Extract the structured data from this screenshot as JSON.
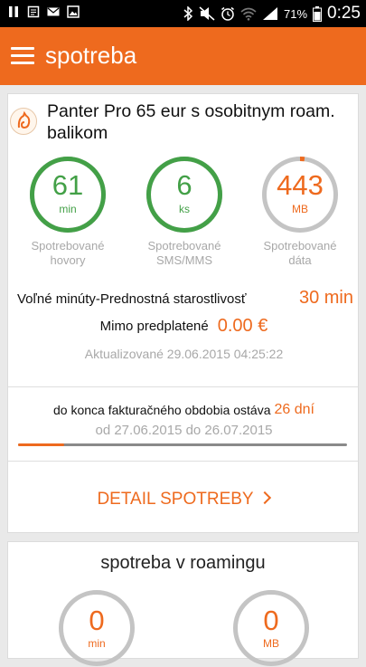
{
  "status_bar": {
    "battery_percent_label": "71%",
    "time": "0:25",
    "icons": [
      "pause-icon",
      "notes-icon",
      "mail-icon",
      "image-icon",
      "bluetooth-icon",
      "mute-icon",
      "alarm-icon",
      "wifi-icon",
      "signal-icon",
      "battery-icon"
    ]
  },
  "app_bar": {
    "title": "spotreba"
  },
  "plan": {
    "name": "Panter Pro 65 eur s osobitnym roam. balikom"
  },
  "gauges": [
    {
      "value": "61",
      "unit": "min",
      "label": "Spotrebované hovory",
      "color": "#43a047",
      "fill_fraction": 1.0
    },
    {
      "value": "6",
      "unit": "ks",
      "label": "Spotrebované SMS/MMS",
      "color": "#43a047",
      "fill_fraction": 1.0
    },
    {
      "value": "443",
      "unit": "MB",
      "label": "Spotrebované dáta",
      "color": "#ee6a1e",
      "fill_fraction": 0.02
    }
  ],
  "free_minutes": {
    "label": "Voľné minúty-Prednostná starostlivosť",
    "value": "30 min"
  },
  "outside_plan": {
    "label": "Mimo predplatené",
    "value": "0.00 €"
  },
  "updated": "Aktualizované 29.06.2015 04:25:22",
  "billing_period": {
    "label": "do konca fakturačného obdobia ostáva",
    "days": "26 dní",
    "dates": "od 27.06.2015 do 26.07.2015",
    "progress_fraction": 0.14
  },
  "detail_button": {
    "label": "DETAIL SPOTREBY"
  },
  "roaming": {
    "title": "spotreba v roamingu",
    "gauges": [
      {
        "value": "0",
        "unit": "min"
      },
      {
        "value": "0",
        "unit": "MB"
      }
    ]
  },
  "colors": {
    "accent": "#ee6a1e",
    "green": "#43a047",
    "grey_text": "#a8a8a8",
    "ring_track": "#c4c4c4"
  }
}
